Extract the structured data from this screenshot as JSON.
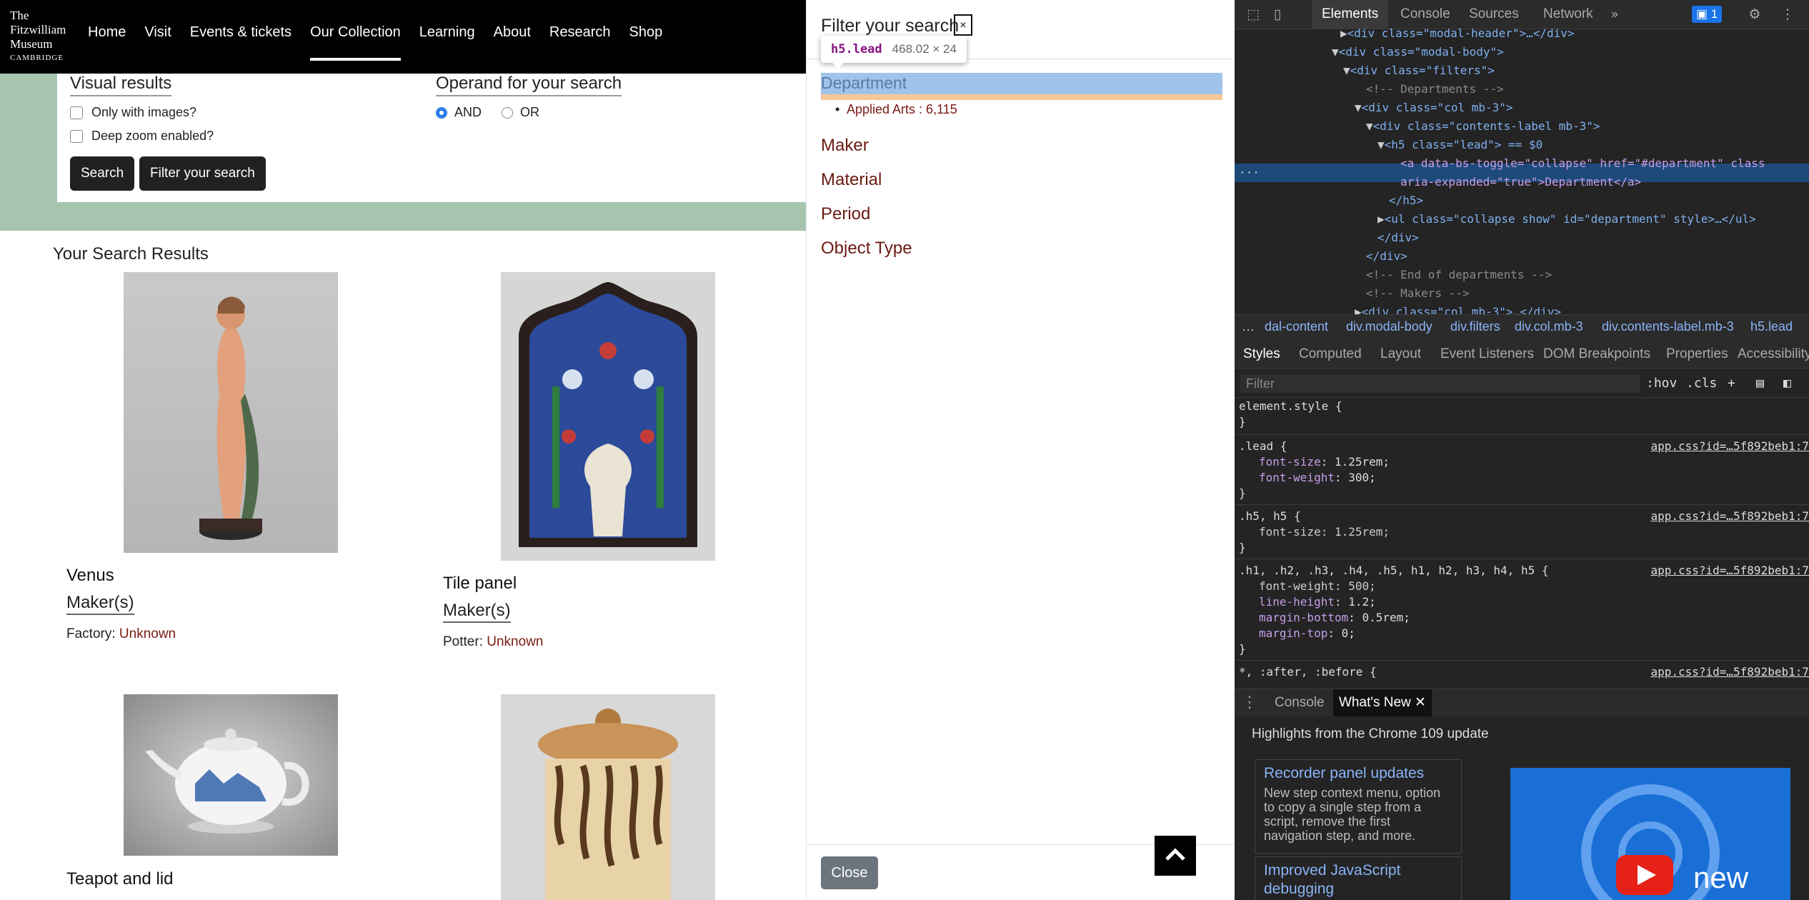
{
  "site": {
    "logo_lines": [
      "The",
      "Fitzwilliam",
      "Museum",
      "CAMBRIDGE"
    ],
    "nav": [
      "Home",
      "Visit",
      "Events & tickets",
      "Our Collection",
      "Learning",
      "About",
      "Research",
      "Shop"
    ],
    "active_nav": "Our Collection"
  },
  "search": {
    "visual_heading": "Visual results",
    "only_images_label": "Only with images?",
    "deep_zoom_label": "Deep zoom enabled?",
    "operand_heading": "Operand for your search",
    "operand_and": "AND",
    "operand_or": "OR",
    "operand_selected": "AND",
    "search_button": "Search",
    "filter_button": "Filter your search"
  },
  "results": {
    "title": "Your Search Results",
    "items": [
      {
        "title": "Venus",
        "maker_link": "Maker(s)",
        "role": "Factory:",
        "role_value": "Unknown"
      },
      {
        "title": "Tile panel",
        "maker_link": "Maker(s)",
        "role": "Potter:",
        "role_value": "Unknown"
      },
      {
        "title": "Teapot and lid"
      },
      {
        "title": ""
      }
    ]
  },
  "modal": {
    "title": "Filter your search",
    "close_x": "×",
    "department": "Department",
    "department_item": "Applied Arts : 6,115",
    "filters": [
      "Maker",
      "Material",
      "Period",
      "Object Type"
    ],
    "close_button": "Close"
  },
  "inspect_tooltip": {
    "tag": "h5.lead",
    "dims": "468.02 × 24"
  },
  "devtools": {
    "tabs": [
      "Elements",
      "Console",
      "Sources",
      "Network"
    ],
    "active_tab": "Elements",
    "issues_count": "1",
    "dom_lines": [
      "<div class=\"modal-header\">…</div>",
      "<div class=\"modal-body\">",
      "<div class=\"filters\">",
      "<!-- Departments -->",
      "<div class=\"col mb-3\">",
      "<div class=\"contents-label mb-3\">",
      "<h5 class=\"lead\"> == $0",
      "<a data-bs-toggle=\"collapse\" href=\"#department\" class",
      "aria-expanded=\"true\">Department</a>",
      "</h5>",
      "<ul class=\"collapse show\" id=\"department\" style>…</ul>",
      "</div>",
      "</div>",
      "<!-- End of departments -->",
      "<!-- Makers -->",
      "<div class=\"col mb-3\">…</div>"
    ],
    "breadcrumbs": [
      "…",
      "dal-content",
      "div.modal-body",
      "div.filters",
      "div.col.mb-3",
      "div.contents-label.mb-3",
      "h5.lead"
    ],
    "styles_tabs": [
      "Styles",
      "Computed",
      "Layout",
      "Event Listeners",
      "DOM Breakpoints",
      "Properties",
      "Accessibility"
    ],
    "filter_placeholder": "Filter",
    "filter_actions": [
      ":hov",
      ".cls",
      "+"
    ],
    "rules": {
      "element_style": "element.style {",
      "lead_selector": ".lead {",
      "lead_props": [
        [
          "font-size",
          "1.25rem;"
        ],
        [
          "font-weight",
          "300;"
        ]
      ],
      "h5_selector": ".h5, h5 {",
      "h5_props": [
        [
          "font-size",
          "1.25rem;"
        ]
      ],
      "headings_selector": ".h1, .h2, .h3, .h4, .h5, h1, h2, h3, h4, h5 {",
      "headings_props": [
        [
          "font-weight",
          "500;"
        ],
        [
          "line-height",
          "1.2;"
        ],
        [
          "margin-bottom",
          "0.5rem;"
        ],
        [
          "margin-top",
          "0;"
        ]
      ],
      "universal_selector": "*, :after, :before {",
      "source": "app.css?id=…5f892beb1:7"
    },
    "drawer_tabs": [
      "Console",
      "What's New"
    ],
    "whats_new": {
      "headline": "Highlights from the Chrome 109 update",
      "card1_title": "Recorder panel updates",
      "card1_body": "New step context menu, option to copy a single step from a script, remove the first navigation step, and more.",
      "card2_title": "Improved JavaScript debugging",
      "video_text": "new"
    }
  },
  "colors": {
    "accent_link": "#7a1a14",
    "highlight": "#a1c3ea",
    "devtools_bg": "#242424"
  }
}
